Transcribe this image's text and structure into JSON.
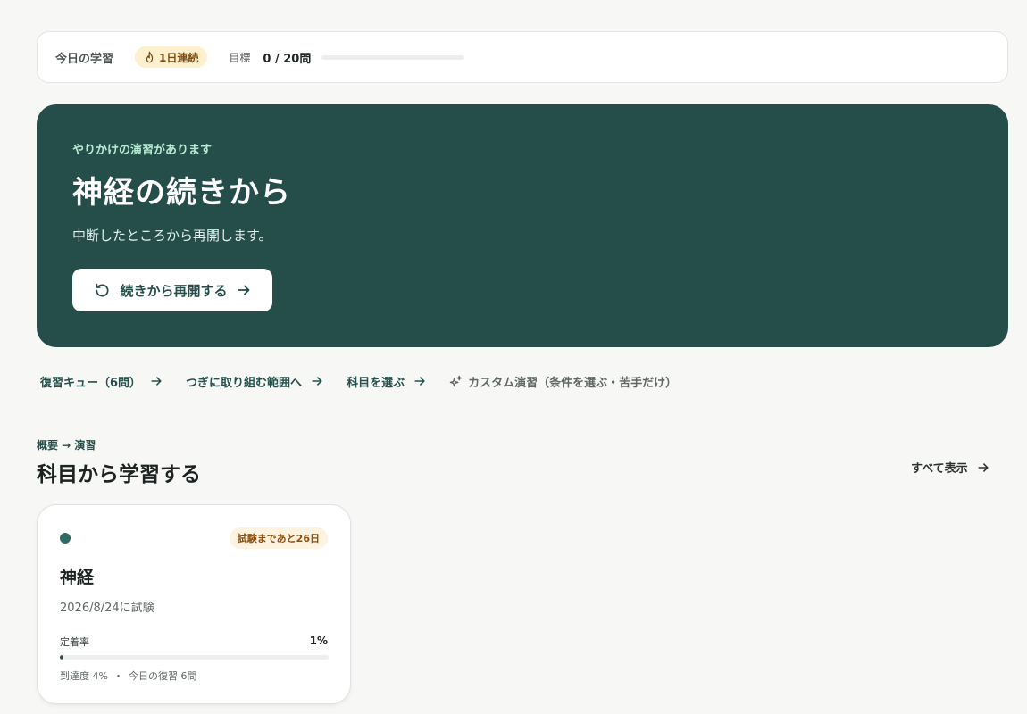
{
  "status_bar": {
    "title": "今日の学習",
    "streak": "1日連続",
    "goal_label": "目標",
    "goal_value": "0 / 20問",
    "goal_progress": 0
  },
  "hero": {
    "eyebrow": "やりかけの演習があります",
    "title": "神経の続きから",
    "description": "中断したところから再開します。",
    "resume_label": "続きから再開する"
  },
  "quick_links": [
    {
      "label": "復習キュー（6問）"
    },
    {
      "label": "つぎに取り組む範囲へ"
    },
    {
      "label": "科目を選ぶ"
    },
    {
      "label": "カスタム演習（条件を選ぶ・苦手だけ）"
    }
  ],
  "section": {
    "eyebrow": "概要 → 演習",
    "title": "科目から学習する",
    "show_all": "すべて表示"
  },
  "subject_card": {
    "exam_badge": "試験まであと26日",
    "title": "神経",
    "date": "2026/8/24に試験",
    "retention_label": "定着率",
    "retention_value": "1%",
    "retention_progress": 0.01,
    "mastery": "到達度 4%",
    "separator": "・",
    "today_review": "今日の復習 6問"
  },
  "colors": {
    "accent": "#254e4a",
    "accent_light": "#b9ecd5",
    "streak_bg": "#fdf0cf",
    "exam_badge_bg": "#fdf3e0"
  },
  "icons": {
    "streak": "flame-icon",
    "resume": "rotate-ccw-icon",
    "arrow": "arrow-right-icon",
    "custom": "sparkles-icon"
  }
}
